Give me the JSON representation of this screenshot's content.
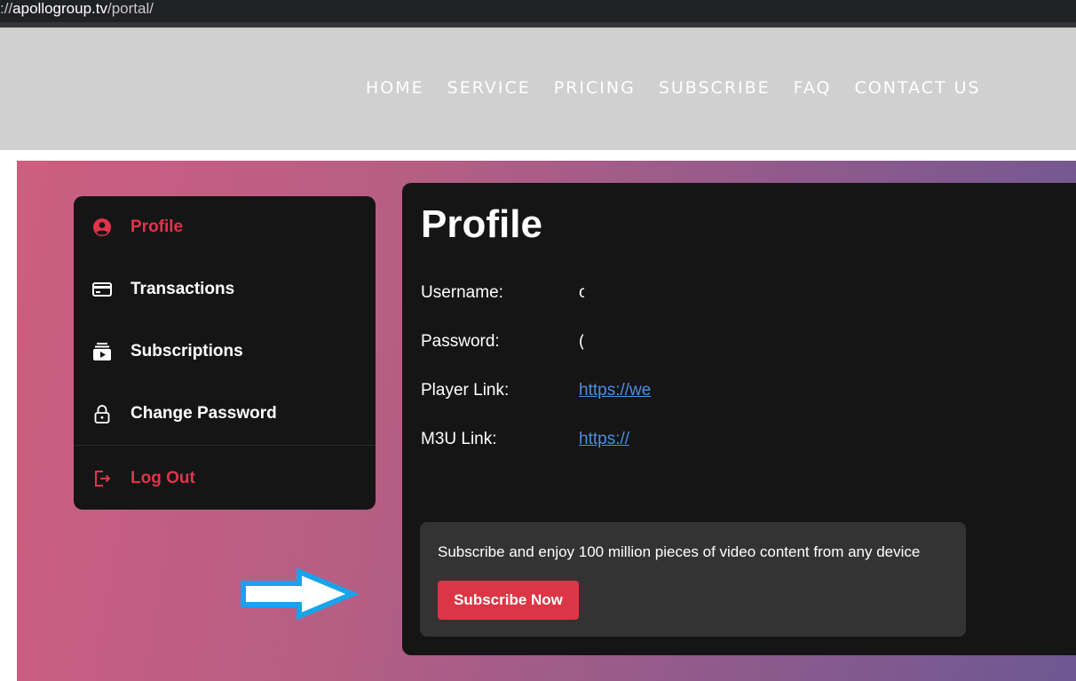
{
  "browser": {
    "url_prefix": "://",
    "url_host": "apollogroup.tv",
    "url_path": "/portal/"
  },
  "nav": {
    "items": [
      "HOME",
      "SERVICE",
      "PRICING",
      "SUBSCRIBE",
      "FAQ",
      "CONTACT US"
    ]
  },
  "sidebar": {
    "items": [
      {
        "label": "Profile",
        "icon": "user-circle-icon",
        "active": true
      },
      {
        "label": "Transactions",
        "icon": "credit-card-icon"
      },
      {
        "label": "Subscriptions",
        "icon": "subscriptions-icon"
      },
      {
        "label": "Change Password",
        "icon": "lock-icon"
      }
    ],
    "logout": {
      "label": "Log Out",
      "icon": "logout-icon"
    }
  },
  "profile": {
    "title": "Profile",
    "fields": [
      {
        "label": "Username:",
        "value": "c"
      },
      {
        "label": "Password:",
        "value": "("
      },
      {
        "label": "Player Link:",
        "value": "https://we"
      },
      {
        "label": "M3U Link:",
        "value": "https://"
      }
    ]
  },
  "promo": {
    "text": "Subscribe and enjoy 100 million pieces of video content from any device",
    "button_label": "Subscribe Now"
  },
  "colors": {
    "accent": "#e0344b",
    "button": "#dc3545",
    "link": "#4a8fe0",
    "header_bg": "#d0d0d0",
    "panel_bg": "#151515",
    "arrow": "#1aa3e8"
  }
}
